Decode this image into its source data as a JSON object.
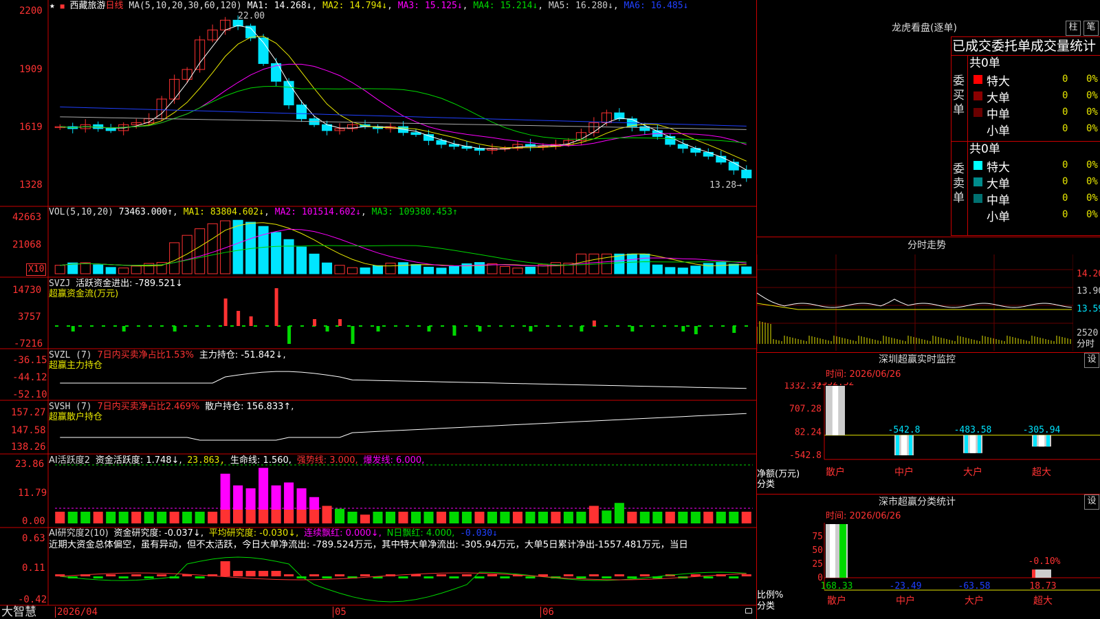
{
  "colors": {
    "up": "#ff3232",
    "down": "#00e5ff",
    "green": "#00d800",
    "magenta": "#ff00ff",
    "yellow": "#e8e800",
    "white": "#ffffff",
    "grid": "#c00000",
    "blue": "#2040ff"
  },
  "main": {
    "star": "★",
    "flag": "■",
    "stock_name": "西藏旅游",
    "period": "日线",
    "ma_label": "MA(5,10,20,30,60,120)",
    "ma1": "MA1: 14.268↓",
    "ma2": "MA2: 14.794↓",
    "ma3": "MA3: 15.125↓",
    "ma4": "MA4: 15.214↓",
    "ma5": "MA5: 16.280↓",
    "ma6": "MA6: 16.485↓",
    "y_ticks": [
      "2200",
      "1909",
      "1619",
      "1328"
    ],
    "high_label": "22.00",
    "low_label": "13.28→"
  },
  "vol": {
    "label": "VOL(5,10,20)",
    "value": "73463.000↑",
    "ma1": "MA1: 83804.602↓",
    "ma2": "MA2: 101514.602↓",
    "ma3": "MA3: 109380.453↑",
    "y_ticks": [
      "42663",
      "21068"
    ],
    "unit": "X10"
  },
  "svzj": {
    "name": "SVZJ",
    "label": "活跃资金进出: -789.521↓",
    "sub": "超赢资金流(万元)",
    "y_ticks": [
      "14730",
      "3757",
      "-7216"
    ]
  },
  "svzl": {
    "name": "SVZL (7)",
    "p1": "7日内买卖净占比1.53%",
    "p2": "主力持仓: -51.842↓,",
    "sub": "超赢主力持仓",
    "y_ticks": [
      "-36.15",
      "-44.12",
      "-52.10"
    ]
  },
  "svsh": {
    "name": "SVSH (7)",
    "p1": "7日内买卖净占比2.469%",
    "p2": "散户持仓: 156.833↑,",
    "sub": "超赢散户持仓",
    "y_ticks": [
      "157.27",
      "147.58",
      "138.26"
    ]
  },
  "ai1": {
    "name": "AI活跃度2",
    "p1": "资金活跃度: 1.748↓,",
    "p2": "23.863,",
    "p3": "生命线: 1.560,",
    "p4": "强势线: 3.000,",
    "p5": "爆发线: 6.000,",
    "y_ticks": [
      "23.86",
      "11.79",
      "0.00"
    ]
  },
  "ai2": {
    "name": "AI研究度2(10)",
    "p1": "资金研究度: -0.037↓,",
    "p2": "平均研究度: -0.030↓,",
    "p3": "连续飘红: 0.000↓,",
    "p4": "N日飘红: 4.000,",
    "p5": "-0.030↓",
    "text": "近期大资金总体偏空，虽有异动，但不太活跃，今日大单净流出: -789.524万元，其中特大单净流出: -305.94万元，大单5日累计净出-1557.481万元，当日",
    "y_ticks": [
      "0.63",
      "0.11",
      "-0.42"
    ]
  },
  "footer": {
    "brand": "大智慧",
    "date": "2026/04",
    "m05": "05",
    "m06": "06"
  },
  "lhb": {
    "title": "龙虎看盘(逐单)",
    "btn1": "柱",
    "btn2": "笔",
    "heading": "已成交委托单成交量统计",
    "buy": {
      "side": "委买单",
      "total": "共0单",
      "rows": [
        {
          "name": "特大",
          "n": "0",
          "p": "0%"
        },
        {
          "name": "大单",
          "n": "0",
          "p": "0%"
        },
        {
          "name": "中单",
          "n": "0",
          "p": "0%"
        },
        {
          "name": "小单",
          "n": "0",
          "p": "0%"
        }
      ]
    },
    "sell": {
      "side": "委卖单",
      "total": "共0单",
      "rows": [
        {
          "name": "特大",
          "n": "0",
          "p": "0%"
        },
        {
          "name": "大单",
          "n": "0",
          "p": "0%"
        },
        {
          "name": "中单",
          "n": "0",
          "p": "0%"
        },
        {
          "name": "小单",
          "n": "0",
          "p": "0%"
        }
      ]
    }
  },
  "fenshi": {
    "title": "分时走势",
    "y_ticks": [
      "14.20",
      "13.90",
      "13.59"
    ],
    "vol_tick": "2520",
    "vol_unit": "分时"
  },
  "monitor": {
    "title": "深圳超赢实时监控",
    "btn": "设",
    "time": "时间: 2026/06/26",
    "y_ticks": [
      "1332.32",
      "707.28",
      "82.24",
      "-542.8"
    ],
    "ylabel": "净额(万元)",
    "xlabel": "分类",
    "top_label": "1332.32",
    "cats": [
      "散户",
      "中户",
      "大户",
      "超大"
    ],
    "vals": [
      1332.32,
      -542.8,
      -483.58,
      -305.94
    ],
    "val_labels": [
      "",
      "-542.8",
      "-483.58",
      "-305.94"
    ]
  },
  "stats": {
    "title": "深市超赢分类统计",
    "btn": "设",
    "time": "时间: 2026/06/26",
    "y_ticks": [
      "75",
      "50",
      "25",
      "0"
    ],
    "ylabel": "比例%",
    "xlabel": "分类",
    "cats": [
      "散户",
      "中户",
      "大户",
      "超大"
    ],
    "vals": [
      168.33,
      -23.49,
      -63.58,
      18.73
    ],
    "val_labels": [
      "168.33",
      "-23.49",
      "-63.58",
      "18.73"
    ],
    "top_label": "-0.10%"
  },
  "chart_data": {
    "type": "line",
    "title": "西藏旅游 日线",
    "candles_close_approx": [
      16.1,
      16.0,
      16.2,
      16.0,
      15.9,
      16.2,
      16.3,
      16.5,
      17.5,
      18.5,
      19.0,
      20.5,
      21.0,
      21.5,
      21.2,
      20.6,
      19.3,
      18.4,
      17.2,
      16.5,
      16.2,
      15.9,
      16.0,
      16.2,
      16.1,
      16.0,
      16.1,
      15.8,
      15.7,
      15.4,
      15.2,
      15.1,
      15.0,
      14.9,
      15.0,
      15.0,
      15.2,
      15.1,
      15.1,
      15.2,
      15.4,
      15.8,
      16.3,
      16.8,
      16.5,
      16.1,
      15.9,
      15.6,
      15.2,
      15.0,
      14.8,
      14.6,
      14.3,
      13.9,
      13.5
    ],
    "ylim": [
      13.28,
      22.0
    ],
    "series": [
      {
        "name": "MA1",
        "values": []
      },
      {
        "name": "MA2",
        "values": []
      },
      {
        "name": "MA3",
        "values": []
      },
      {
        "name": "MA4",
        "values": []
      },
      {
        "name": "MA5",
        "values": []
      },
      {
        "name": "MA6",
        "values": []
      }
    ]
  }
}
